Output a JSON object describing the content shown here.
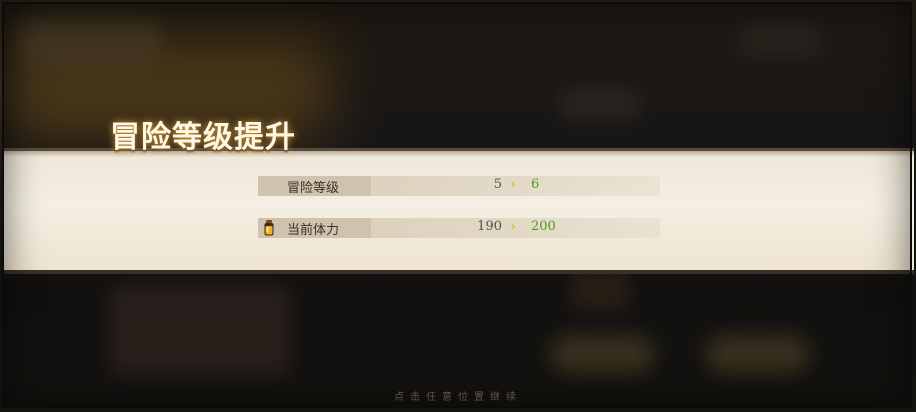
{
  "dialog": {
    "title": "冒险等级提升"
  },
  "stats": [
    {
      "label": "冒险等级",
      "old_value": "5",
      "new_value": "6",
      "icon": ""
    },
    {
      "label": "当前体力",
      "old_value": "190",
      "new_value": "200",
      "icon": "stamina-potion-icon"
    }
  ],
  "arrow_glyph": "›",
  "footer": {
    "hint": "点击任意位置继续"
  },
  "colors": {
    "new_value": "#4e9a1e",
    "arrow": "#e2b847",
    "title_glow": "#ffbe50"
  }
}
